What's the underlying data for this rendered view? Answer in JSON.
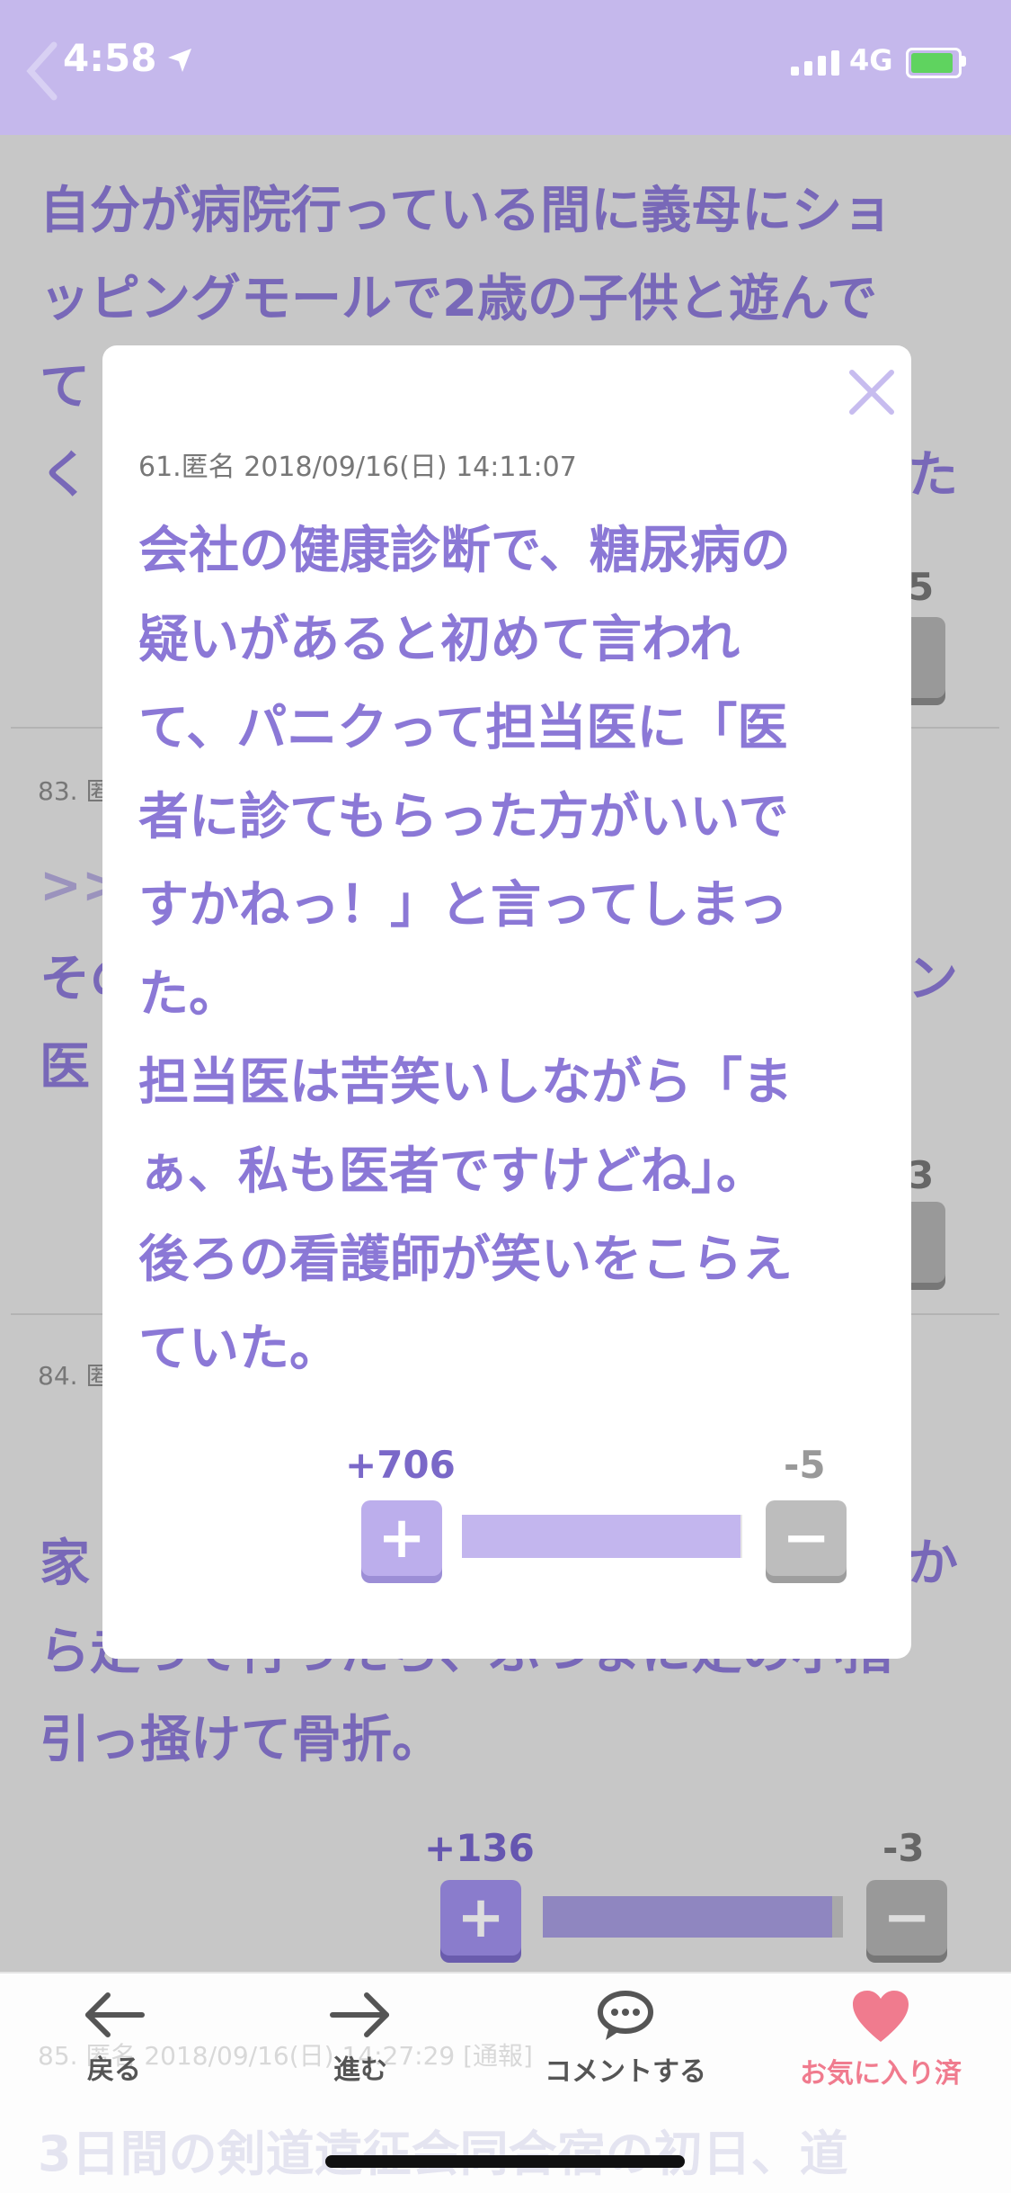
{
  "status_bar": {
    "time": "4:58",
    "network": "4G"
  },
  "background_feed": {
    "post_top_lines": [
      "自分が病院行っている間に義母にショ",
      "ッピングモールで2歳の子供と遊んで",
      "て",
      "く"
    ],
    "post_top_tail": "た",
    "count_a": "5",
    "post83_meta": "83. 匿",
    "post83_quote": ">>",
    "post83_lines": [
      "その",
      "医"
    ],
    "post83_tail": "ン",
    "count_b": "3",
    "post84_meta": "84. 匿",
    "post84_lines": [
      "家",
      "ら走って行ったら、ぶつまに足の小指",
      "引っ掻けて骨折。"
    ],
    "post84_tail": "か",
    "post84_plus": "+136",
    "post84_minus": "-3",
    "post85_meta": "85. 匿名 2018/09/16(日) 14:27:29 [通報]",
    "post85_text": "3日間の剣道遠征会同合宿の初日、道"
  },
  "modal": {
    "meta": "61.匿名 2018/09/16(日) 14:11:07",
    "body_lines": [
      "会社の健康診断で、糖尿病の",
      "疑いがあると初めて言われ",
      "て、パニクって担当医に「医",
      "者に診てもらった方がいいで",
      "すかねっ！」と言ってしまっ",
      "た。",
      "担当医は苦笑いしながら「ま",
      "ぁ、私も医者ですけどね」。",
      "後ろの看護師が笑いをこらえ",
      "ていた。"
    ],
    "plus_count": "+706",
    "minus_count": "-5",
    "vote_ratio": 0.993
  },
  "toolbar": {
    "back_label": "戻る",
    "forward_label": "進む",
    "comment_label": "コメントする",
    "favorite_label": "お気に入り済"
  },
  "icons": {
    "back": "arrow-left-icon",
    "forward": "arrow-right-icon",
    "comment": "speech-bubble-icon",
    "favorite": "heart-icon",
    "close": "close-icon"
  },
  "colors": {
    "accent": "#8b78d6",
    "header": "#c5b8ec",
    "favorite": "#f07b8e"
  }
}
